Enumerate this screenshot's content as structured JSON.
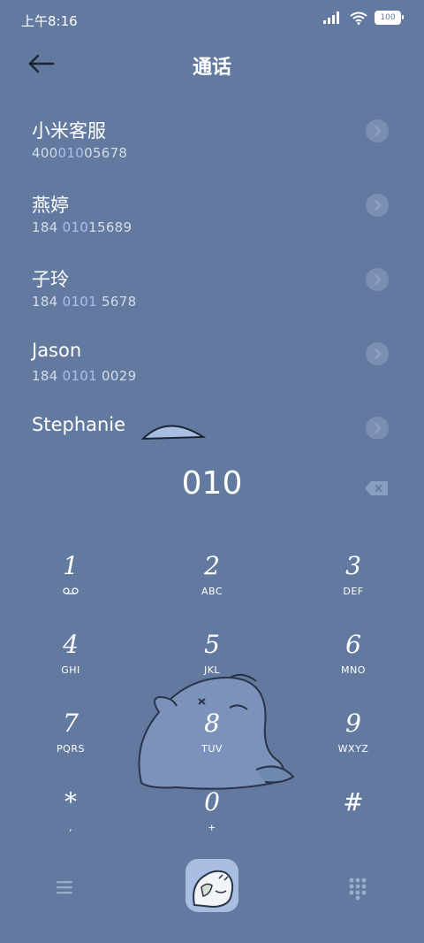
{
  "status_bar": {
    "time": "上午8:16",
    "battery": "100"
  },
  "header": {
    "title": "通话"
  },
  "contacts": [
    {
      "name": "小米客服",
      "number_pre": "400",
      "number_hl": "010",
      "number_post": "05678"
    },
    {
      "name": "燕婷",
      "number_pre": "184 ",
      "number_hl": "010",
      "number_post": "15689"
    },
    {
      "name": "子玲",
      "number_pre": "184 ",
      "number_hl": "0101",
      "number_post": " 5678"
    },
    {
      "name": "Jason",
      "number_pre": "184 ",
      "number_hl": "0101",
      "number_post": " 0029"
    },
    {
      "name": "Stephanie",
      "number_pre": "",
      "number_hl": "",
      "number_post": ""
    }
  ],
  "dialer": {
    "digits": "010"
  },
  "keypad": [
    {
      "num": "1",
      "sub": ""
    },
    {
      "num": "2",
      "sub": "ABC"
    },
    {
      "num": "3",
      "sub": "DEF"
    },
    {
      "num": "4",
      "sub": "GHI"
    },
    {
      "num": "5",
      "sub": "JKL"
    },
    {
      "num": "6",
      "sub": "MNO"
    },
    {
      "num": "7",
      "sub": "PQRS"
    },
    {
      "num": "8",
      "sub": "TUV"
    },
    {
      "num": "9",
      "sub": "WXYZ"
    },
    {
      "num": "*",
      "sub": ","
    },
    {
      "num": "0",
      "sub": "+"
    },
    {
      "num": "#",
      "sub": ""
    }
  ],
  "icons": {
    "back": "back-arrow-icon",
    "chevron": "chevron-right-icon",
    "backspace": "backspace-icon",
    "voicemail": "voicemail-icon",
    "menu": "menu-icon",
    "call": "call-button-shark-sticker",
    "dialpad": "dialpad-icon"
  },
  "colors": {
    "background": "#637aa0",
    "highlight": "#a9c1f2",
    "call_button": "#a8bde1"
  }
}
